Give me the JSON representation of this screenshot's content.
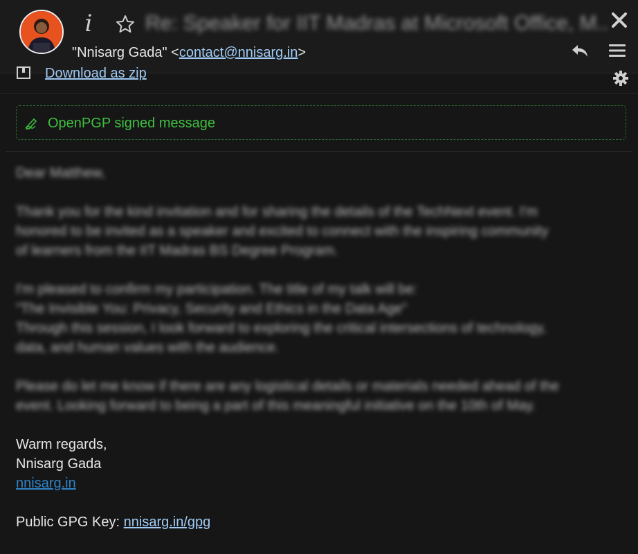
{
  "header": {
    "subject": "Re: Speaker for IIT Madras at Microsoft Office, M...",
    "sender_name": "\"Nnisarg Gada\"",
    "sender_open": "<",
    "sender_email": "contact@nnisarg.in",
    "sender_close": ">",
    "icons": [
      "avatar",
      "info-icon",
      "star-icon",
      "close-icon",
      "reply-icon",
      "menu-icon"
    ]
  },
  "attachments": {
    "download_label": "Download as zip",
    "icons": [
      "zip-icon",
      "gear-icon"
    ]
  },
  "pgp": {
    "label": "OpenPGP signed message",
    "color": "#3fbf3f"
  },
  "body": {
    "greeting": "Dear Matthew,",
    "paragraph1": [
      "Thank you for the kind invitation and for sharing the details of the TechNext event. I'm",
      "honored to be invited as a speaker and excited to connect with the inspiring community",
      "of learners from the IIT Madras BS Degree Program."
    ],
    "paragraph2": [
      "I'm pleased to confirm my participation. The title of my talk will be:",
      "\"The Invisible You: Privacy, Security and Ethics in the Data Age\"",
      "Through this session, I look forward to exploring the critical intersections of technology,",
      "data, and human values with the audience."
    ],
    "paragraph3": [
      "Please do let me know if there are any logistical details or materials needed ahead of the",
      "event. Looking forward to being a part of this meaningful initiative on the 10th of May."
    ],
    "closing": "Warm regards,",
    "signature_name": "Nnisarg Gada",
    "signature_site": "nnisarg.in",
    "gpg_label": "Public GPG Key:",
    "gpg_link": "nnisarg.in/gpg"
  },
  "colors": {
    "background": "#161616",
    "link": "#9fcaf5",
    "signature_link": "#2f84c7",
    "accent_avatar": "#e8521f"
  }
}
